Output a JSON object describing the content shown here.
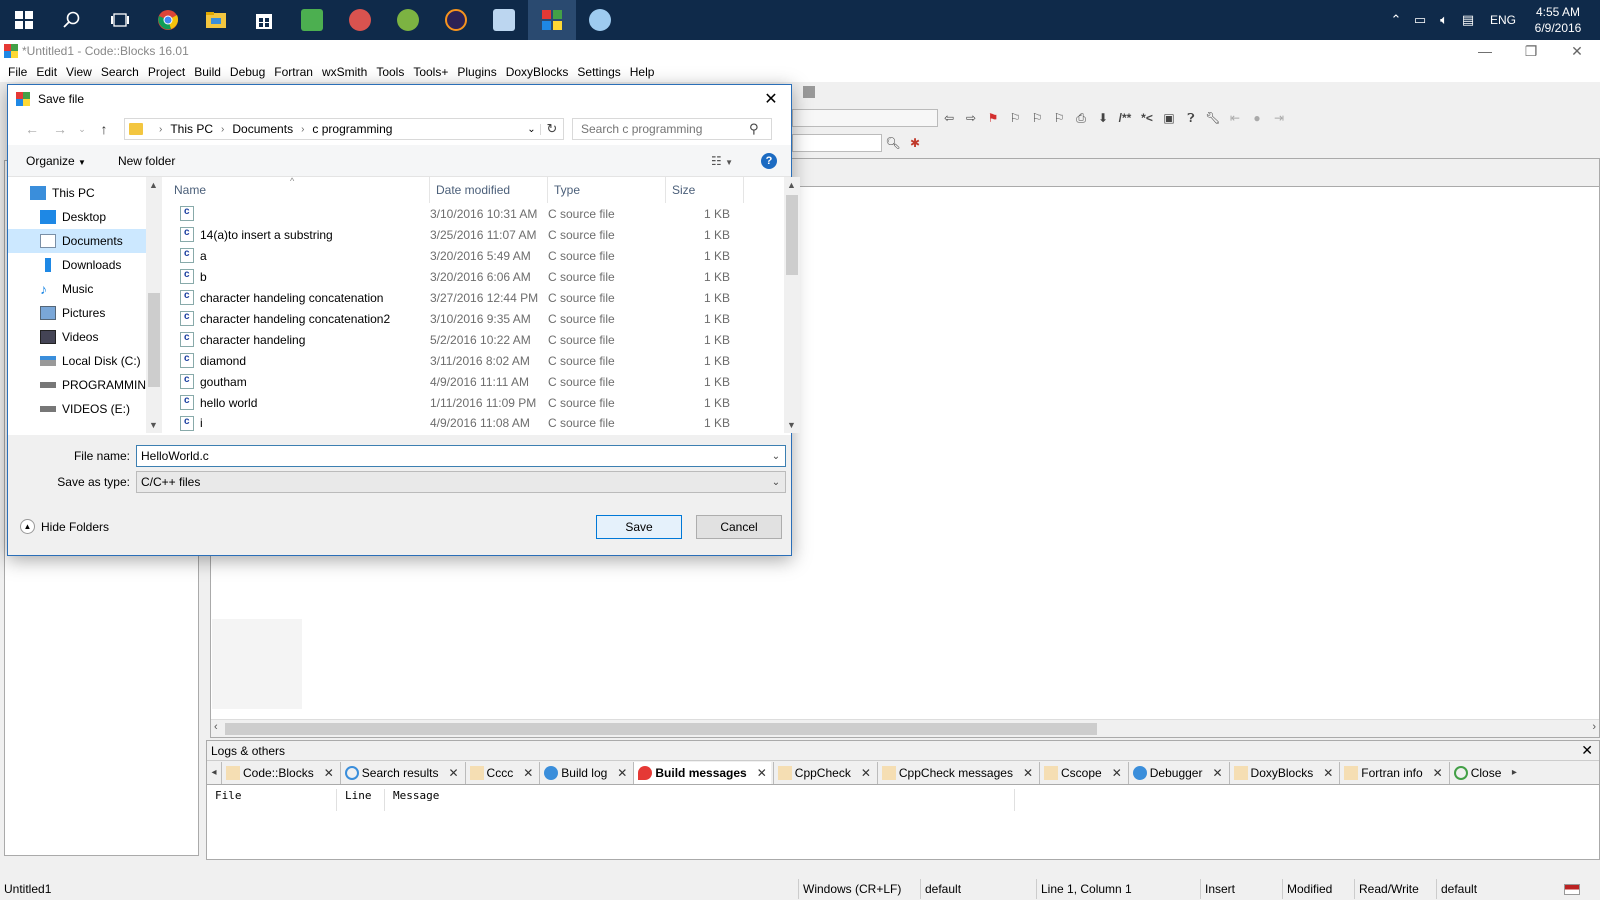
{
  "taskbar": {
    "icons": [
      "windows-start-icon",
      "search-icon",
      "task-view-icon",
      "chrome-icon",
      "file-explorer-icon",
      "store-icon",
      "app-icon",
      "tools-icon",
      "android-studio-icon",
      "eclipse-icon",
      "box-icon",
      "codeblocks-icon",
      "paint-icon"
    ],
    "lang": "ENG",
    "time": "4:55 AM",
    "date": "6/9/2016"
  },
  "window": {
    "title": "*Untitled1 - Code::Blocks 16.01"
  },
  "menu": [
    "File",
    "Edit",
    "View",
    "Search",
    "Project",
    "Build",
    "Debug",
    "Fortran",
    "wxSmith",
    "Tools",
    "Tools+",
    "Plugins",
    "DoxyBlocks",
    "Settings",
    "Help"
  ],
  "toolbar": {
    "comment_label": "/**",
    "comment_end_label": "*<"
  },
  "logs": {
    "title": "Logs & others",
    "tabs": [
      "Code::Blocks",
      "Search results",
      "Cccc",
      "Build log",
      "Build messages",
      "CppCheck",
      "CppCheck messages",
      "Cscope",
      "Debugger",
      "DoxyBlocks",
      "Fortran info",
      "Close"
    ],
    "selected_tab": "Build messages",
    "columns": [
      "File",
      "Line",
      "Message"
    ]
  },
  "status": {
    "file": "Untitled1",
    "eol": "Windows (CR+LF)",
    "encoding": "default",
    "position": "Line 1, Column 1",
    "mode": "Insert",
    "modified": "Modified",
    "access": "Read/Write",
    "profile": "default"
  },
  "dialog": {
    "title": "Save file",
    "breadcrumb": [
      "This PC",
      "Documents",
      "c programming"
    ],
    "search_placeholder": "Search c programming",
    "organize_label": "Organize",
    "new_folder_label": "New folder",
    "help_label": "?",
    "nav_items": [
      {
        "label": "This PC",
        "icon": "computer-icon"
      },
      {
        "label": "Desktop",
        "icon": "desktop-icon"
      },
      {
        "label": "Documents",
        "icon": "documents-icon"
      },
      {
        "label": "Downloads",
        "icon": "downloads-icon"
      },
      {
        "label": "Music",
        "icon": "music-icon"
      },
      {
        "label": "Pictures",
        "icon": "pictures-icon"
      },
      {
        "label": "Videos",
        "icon": "videos-icon"
      },
      {
        "label": "Local Disk (C:)",
        "icon": "drive-icon"
      },
      {
        "label": "PROGRAMMING",
        "icon": "drive-icon"
      },
      {
        "label": "VIDEOS (E:)",
        "icon": "drive-icon"
      }
    ],
    "selected_nav": "Documents",
    "columns": [
      "Name",
      "Date modified",
      "Type",
      "Size"
    ],
    "files": [
      {
        "name": "",
        "date": "3/10/2016 10:31 AM",
        "type": "C source file",
        "size": "1 KB"
      },
      {
        "name": "14(a)to insert a substring",
        "date": "3/25/2016 11:07 AM",
        "type": "C source file",
        "size": "1 KB"
      },
      {
        "name": "a",
        "date": "3/20/2016 5:49 AM",
        "type": "C source file",
        "size": "1 KB"
      },
      {
        "name": "b",
        "date": "3/20/2016 6:06 AM",
        "type": "C source file",
        "size": "1 KB"
      },
      {
        "name": "character handeling concatenation",
        "date": "3/27/2016 12:44 PM",
        "type": "C source file",
        "size": "1 KB"
      },
      {
        "name": "character handeling concatenation2",
        "date": "3/10/2016 9:35 AM",
        "type": "C source file",
        "size": "1 KB"
      },
      {
        "name": "character handeling",
        "date": "5/2/2016 10:22 AM",
        "type": "C source file",
        "size": "1 KB"
      },
      {
        "name": "diamond",
        "date": "3/11/2016 8:02 AM",
        "type": "C source file",
        "size": "1 KB"
      },
      {
        "name": "goutham",
        "date": "4/9/2016 11:11 AM",
        "type": "C source file",
        "size": "1 KB"
      },
      {
        "name": "hello world",
        "date": "1/11/2016 11:09 PM",
        "type": "C source file",
        "size": "1 KB"
      },
      {
        "name": "i",
        "date": "4/9/2016 11:08 AM",
        "type": "C source file",
        "size": "1 KB"
      }
    ],
    "file_name_label": "File name:",
    "file_name_value": "HelloWorld.c",
    "save_type_label": "Save as type:",
    "save_type_value": "C/C++ files",
    "hide_folders_label": "Hide Folders",
    "save_label": "Save",
    "cancel_label": "Cancel"
  }
}
